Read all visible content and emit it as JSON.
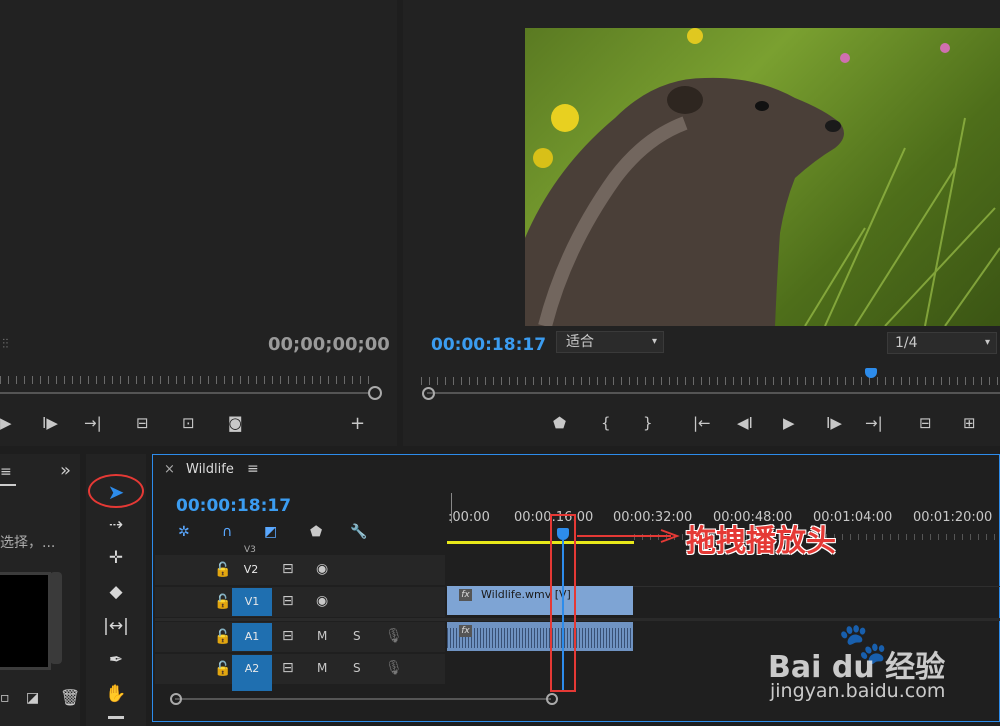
{
  "source_monitor": {
    "timecode": "00;00;00;00",
    "controls": [
      "play-icon",
      "step-forward-icon",
      "go-to-out-icon",
      "insert-icon",
      "overwrite-icon",
      "camera-icon",
      "plus-icon"
    ]
  },
  "program_monitor": {
    "timecode": "00:00:18:17",
    "fit_label": "适合",
    "resolution_label": "1/4",
    "controls": [
      "marker-icon",
      "mark-in-icon",
      "mark-out-icon",
      "go-to-in-icon",
      "step-back-icon",
      "play-icon",
      "step-forward-icon",
      "go-to-out-icon",
      "lift-icon",
      "extract-icon"
    ]
  },
  "project_panel": {
    "overflow_label": "»",
    "hint_text": "选择，..."
  },
  "timeline": {
    "close_label": "×",
    "sequence_name": "Wildlife",
    "menu_label": "≡",
    "timecode": "00:00:18:17",
    "ruler_labels": [
      ":00:00",
      "00:00:16:00",
      "00:00:32:00",
      "00:00:48:00",
      "00:01:04:00",
      "00:01:20:00"
    ],
    "tracks": [
      {
        "name": "V3",
        "type": "video"
      },
      {
        "name": "V2",
        "type": "video"
      },
      {
        "name": "V1",
        "type": "video",
        "targeted": true
      },
      {
        "name": "A1",
        "type": "audio",
        "targeted": true
      },
      {
        "name": "A2",
        "type": "audio",
        "targeted": true
      }
    ],
    "audio_buttons": {
      "mute": "M",
      "solo": "S"
    },
    "clip_video_label": "Wildlife.wmv [V]",
    "clip_fx_label": "fx"
  },
  "annotation": {
    "text": "拖拽播放头"
  },
  "watermark": {
    "brand": "Bai du 经验",
    "url": "jingyan.baidu.com"
  },
  "colors": {
    "accent_blue": "#2d8ceb",
    "timecode_blue": "#3b9cf0",
    "track_target": "#1f6fb0",
    "clip_blue": "#7ea4d4",
    "annotation_red": "#e53935",
    "work_area_yellow": "#e8e81a"
  }
}
